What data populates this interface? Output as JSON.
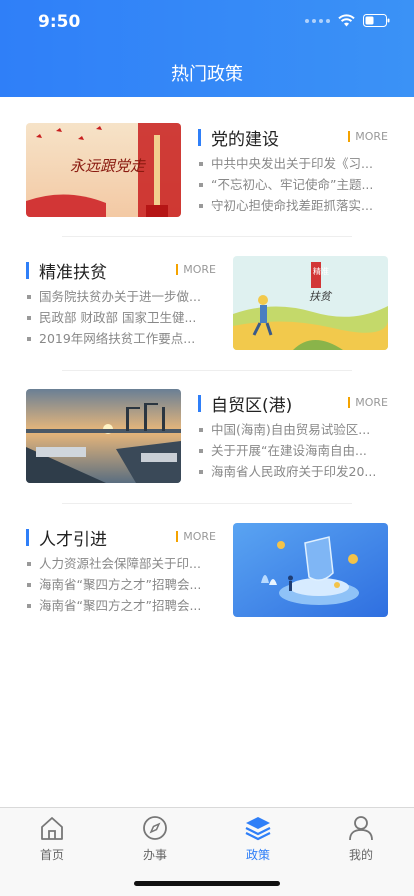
{
  "status_bar": {
    "time": "9:50"
  },
  "header": {
    "title": "热门政策"
  },
  "more_label": "MORE",
  "sections": [
    {
      "title": "党的建设",
      "image_text": "永远跟党走",
      "items": [
        "中共中央发出关于印发《习...",
        "“不忘初心、牢记使命”主题...",
        "守初心担使命找差距抓落实..."
      ]
    },
    {
      "title": "精准扶贫",
      "image_text_top": "精准",
      "image_text_bottom": "扶贫",
      "items": [
        "国务院扶贫办关于进一步做...",
        "民政部 财政部 国家卫生健...",
        "2019年网络扶贫工作要点..."
      ]
    },
    {
      "title": "自贸区(港)",
      "items": [
        "中国(海南)自由贸易试验区...",
        "关于开展“在建设海南自由...",
        "海南省人民政府关于印发20..."
      ]
    },
    {
      "title": "人才引进",
      "items": [
        "人力资源社会保障部关于印...",
        "海南省“聚四方之才”招聘会...",
        "海南省“聚四方之才”招聘会..."
      ]
    }
  ],
  "tabbar": {
    "items": [
      {
        "label": "首页",
        "icon": "home-icon"
      },
      {
        "label": "办事",
        "icon": "compass-icon"
      },
      {
        "label": "政策",
        "icon": "layers-icon",
        "active": true
      },
      {
        "label": "我的",
        "icon": "user-icon"
      }
    ]
  },
  "colors": {
    "accent": "#2f7ff8",
    "more_bar": "#f4a300"
  }
}
